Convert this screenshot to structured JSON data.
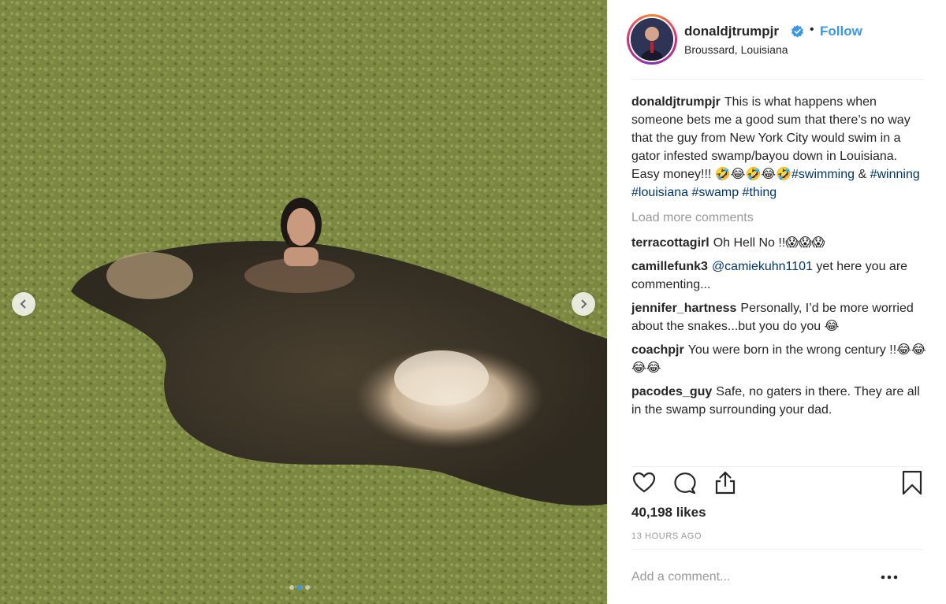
{
  "post": {
    "username": "donaldjtrumpjr",
    "location": "Broussard, Louisiana",
    "follow_label": "Follow",
    "separator": "•",
    "verified_icon": "verified-badge-icon",
    "caption": {
      "user": "donaldjtrumpjr",
      "text": "This is what happens when someone bets me a good sum that there’s no way that the guy from New York City would swim in a gator infested swamp/bayou down in Louisiana. Easy money!!! 🤣😂🤣😂🤣",
      "hashtags": [
        "#swimming",
        "#winning",
        "#louisiana",
        "#swamp",
        "#thing"
      ],
      "joiner": "&"
    },
    "load_more_label": "Load more comments",
    "comments": [
      {
        "user": "terracottagirl",
        "text": "Oh Hell No !!😱😱😱"
      },
      {
        "user": "camillefunk3",
        "mention": "@camiekuhn1101",
        "text": "yet here you are commenting..."
      },
      {
        "user": "jennifer_hartness",
        "text": "Personally, I’d be more worried about the snakes...but you do you 😂"
      },
      {
        "user": "coachpjr",
        "text": "You were born in the wrong century !!😂😂😂😂"
      },
      {
        "user": "pacodes_guy",
        "text": "Safe, no gaters in there. They are all in the swamp surrounding your dad."
      }
    ],
    "likes": "40,198 likes",
    "timestamp": "13 HOURS AGO",
    "add_comment_placeholder": "Add a comment...",
    "icons": [
      "heart-icon",
      "comment-icon",
      "share-icon",
      "bookmark-icon",
      "more-options-icon"
    ],
    "carousel": {
      "total_slides": 3,
      "active_slide": 2
    },
    "colors": {
      "accent": "#3897f0",
      "hashtag": "#003569",
      "muted": "#999999",
      "text": "#262626"
    }
  }
}
